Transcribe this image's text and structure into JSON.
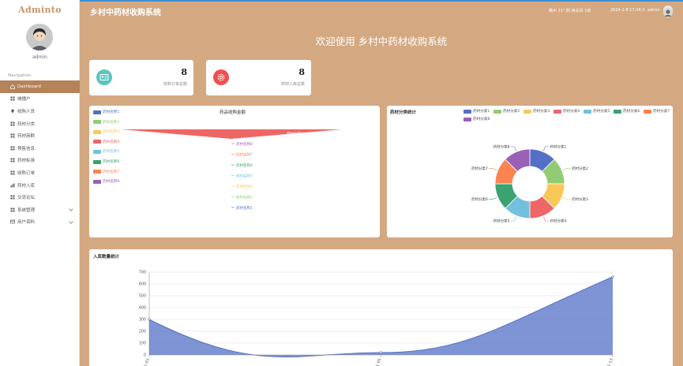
{
  "app": {
    "logo": "Adminto",
    "username": "admin",
    "title": "乡村中药材收购系统",
    "welcome": "欢迎使用 乡村中药材收购系统"
  },
  "header": {
    "weather": "赣州  11°  阴  西北风  1级",
    "time": "2024-1-8 17:24:3",
    "user": "admin"
  },
  "sidebar": {
    "nav_label": "Navigation",
    "items": [
      {
        "label": "Dashboard",
        "icon": "home-icon",
        "active": true
      },
      {
        "label": "摊播户",
        "icon": "grid-icon"
      },
      {
        "label": "收购人员",
        "icon": "pin-icon"
      },
      {
        "label": "药材分类",
        "icon": "grid-icon"
      },
      {
        "label": "药材商群",
        "icon": "grid-icon"
      },
      {
        "label": "预售信息",
        "icon": "grid-icon"
      },
      {
        "label": "药材标准",
        "icon": "grid-icon"
      },
      {
        "label": "收购订单",
        "icon": "grid-icon"
      },
      {
        "label": "药材入库",
        "icon": "bar-icon"
      },
      {
        "label": "交流论坛",
        "icon": "grid-icon"
      },
      {
        "label": "系统管理",
        "icon": "grid-icon",
        "chevron": true
      },
      {
        "label": "用户资料",
        "icon": "card-icon",
        "chevron": true
      }
    ]
  },
  "stats": [
    {
      "value": "8",
      "label": "收购订单总数",
      "color": "#5bc4bf",
      "icon": "id-card-icon"
    },
    {
      "value": "8",
      "label": "药材入库总数",
      "color": "#f05050",
      "icon": "gear-icon"
    }
  ],
  "funnel": {
    "title": "药品收购金额",
    "legend": [
      "药材名称1",
      "药材名称2",
      "药材名称3",
      "药材名称4",
      "药材名称5",
      "药材名称6",
      "药材名称7",
      "药材名称8"
    ],
    "colors": [
      "#5470c6",
      "#91cc75",
      "#fac858",
      "#ee6666",
      "#73c0de",
      "#3ba272",
      "#fc8452",
      "#9a60b4"
    ],
    "labels": [
      "药材名称8",
      "药材名称7",
      "药材名称6",
      "药材名称5",
      "药材名称3",
      "药材名称2",
      "药材名称1"
    ],
    "inner_label": "药材名称4"
  },
  "pie": {
    "title": "药材分类统计",
    "legend": [
      "药材分类1",
      "药材分类2",
      "药材分类3",
      "药材分类4",
      "药材分类5",
      "药材分类6",
      "药材分类7",
      "药材分类8"
    ],
    "colors": [
      "#5470c6",
      "#91cc75",
      "#fac858",
      "#ee6666",
      "#73c0de",
      "#3ba272",
      "#fc8452",
      "#9a60b4"
    ]
  },
  "line": {
    "title": "入库数量统计",
    "y_ticks": [
      "0",
      "100",
      "200",
      "300",
      "400",
      "500",
      "600",
      "700"
    ],
    "x_labels": [
      "2024-01-03",
      "2024-01-05",
      "2024-01-13"
    ],
    "color": "#5470c6"
  },
  "chart_data": [
    {
      "type": "funnel",
      "title": "药品收购金额",
      "categories": [
        "药材名称1",
        "药材名称2",
        "药材名称3",
        "药材名称4",
        "药材名称5",
        "药材名称6",
        "药材名称7",
        "药材名称8"
      ],
      "values": [
        0,
        0,
        0,
        100,
        0,
        0,
        0,
        0
      ]
    },
    {
      "type": "pie",
      "title": "药材分类统计",
      "categories": [
        "药材分类1",
        "药材分类2",
        "药材分类3",
        "药材分类4",
        "药材分类5",
        "药材分类6",
        "药材分类7",
        "药材分类8"
      ],
      "values": [
        1,
        1,
        1,
        1,
        1,
        1,
        1,
        1
      ]
    },
    {
      "type": "area",
      "title": "入库数量统计",
      "x": [
        "2024-01-03",
        "2024-01-05",
        "2024-01-13"
      ],
      "values": [
        300,
        20,
        660
      ],
      "ylim": [
        0,
        700
      ]
    }
  ]
}
